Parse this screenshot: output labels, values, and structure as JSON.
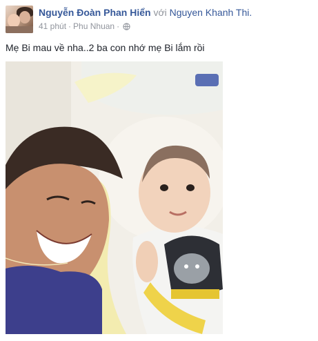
{
  "post": {
    "author": "Nguyễn Đoàn Phan Hiển",
    "with_word": "với",
    "tagged_user": "Nguyen Khanh Thi.",
    "time": "41 phút",
    "separator": "·",
    "location": "Phu Nhuan",
    "privacy_icon": "globe-icon",
    "status_text": "Mẹ Bi mau về nha..2 ba con nhớ mẹ Bi lắm rồi"
  },
  "colors": {
    "link": "#365899",
    "meta": "#90949c",
    "text": "#1d2129"
  }
}
